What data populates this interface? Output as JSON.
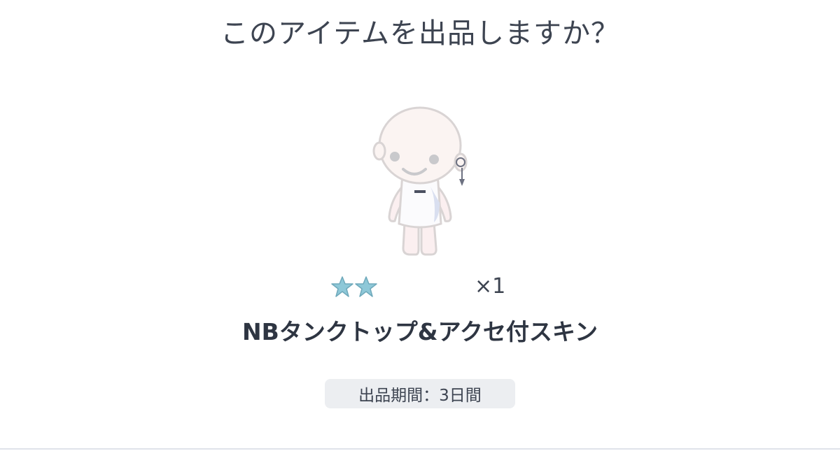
{
  "dialog": {
    "title": "このアイテムを出品しますか？",
    "item": {
      "image_icon": "avatar-skin-icon",
      "rarity_stars": 2,
      "quantity": "×1",
      "name": "NBタンクトップ&アクセ付スキン"
    },
    "period_badge": "出品期間：3日間"
  },
  "colors": {
    "title_text": "#3d4451",
    "badge_bg": "#eceef1",
    "star_fill": "#8ec8d8"
  }
}
